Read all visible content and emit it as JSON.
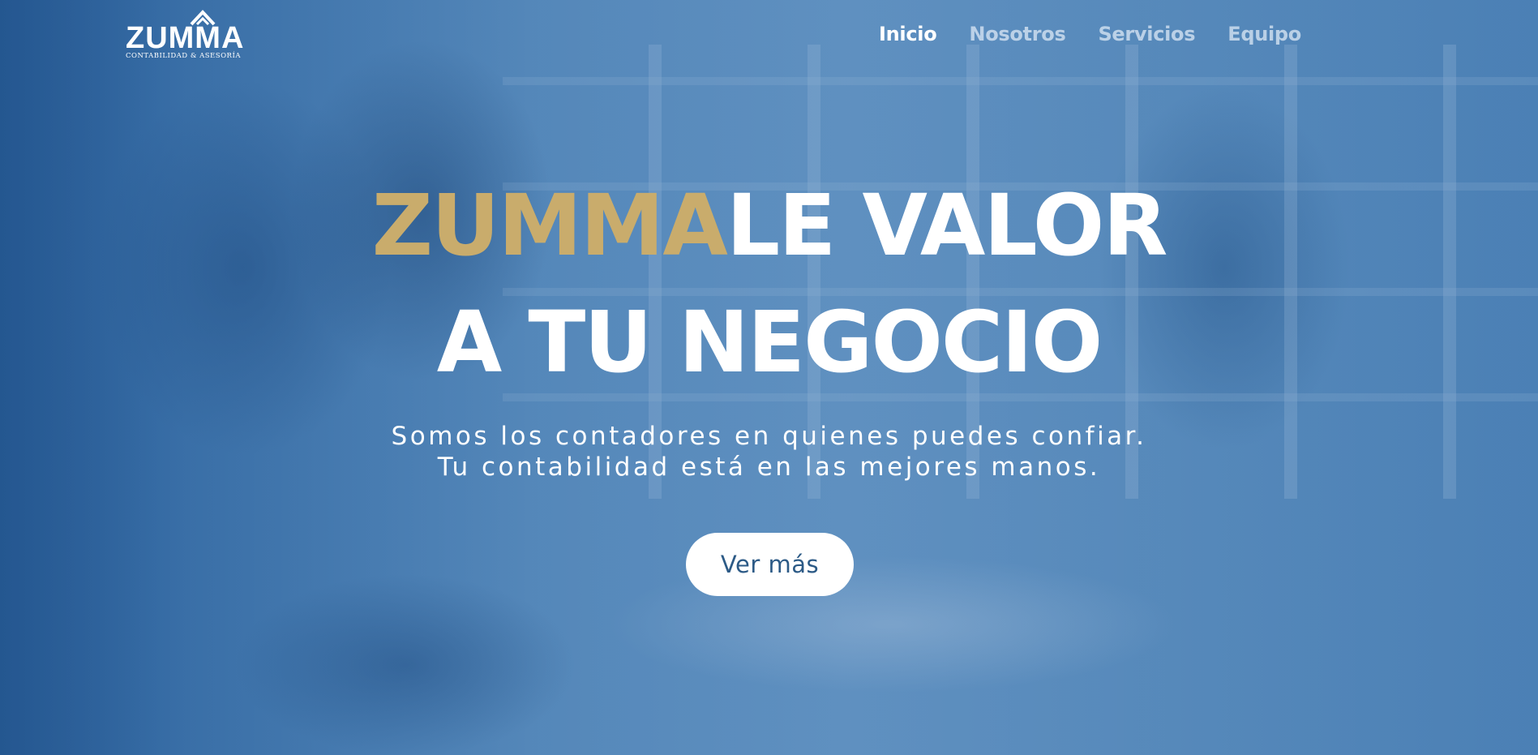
{
  "brand": {
    "logo_text": "ZUMMA",
    "logo_subtitle": "CONTABILIDAD & ASESORÍA"
  },
  "nav": {
    "items": [
      {
        "label": "Inicio",
        "active": true
      },
      {
        "label": "Nosotros",
        "active": false
      },
      {
        "label": "Servicios",
        "active": false
      },
      {
        "label": "Equipo",
        "active": false
      }
    ]
  },
  "hero": {
    "headline_brand": "ZUMMA",
    "headline_rest": "LE VALOR",
    "headline_line2": "A TU NEGOCIO",
    "subtitle_line1": "Somos los contadores en quienes puedes confiar.",
    "subtitle_line2": "Tu contabilidad está en las mejores manos.",
    "cta_label": "Ver más"
  },
  "colors": {
    "accent_gold": "#c9ac6c",
    "overlay_blue": "#3f74ab",
    "text_white": "#ffffff",
    "button_text": "#2c5a86"
  }
}
